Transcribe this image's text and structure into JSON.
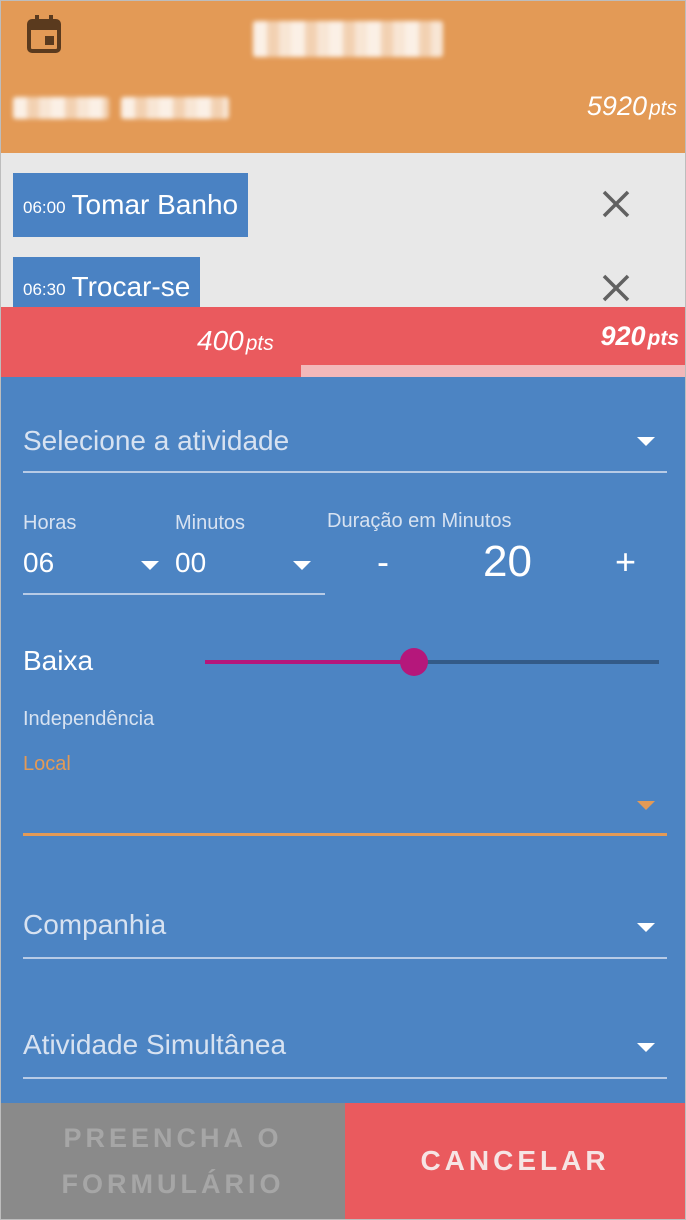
{
  "header": {
    "calendar_icon": "calendar-icon",
    "points_value": "5920",
    "points_unit": "pts"
  },
  "tasks": [
    {
      "time": "06:00",
      "name": "Tomar Banho",
      "remove_icon": "close-icon"
    },
    {
      "time": "06:30",
      "name": "Trocar-se",
      "remove_icon": "close-icon"
    }
  ],
  "points_bar": {
    "current_value": "400",
    "current_unit": "pts",
    "target_value": "920",
    "target_unit": "pts"
  },
  "form": {
    "activity_placeholder": "Selecione a atividade",
    "hours_label": "Horas",
    "hours_value": "06",
    "minutes_label": "Minutos",
    "minutes_value": "00",
    "duration_label": "Duração em Minutos",
    "duration_minus": "-",
    "duration_value": "20",
    "duration_plus": "+",
    "intensity_label": "Baixa",
    "intensity_level": 0.46,
    "independence_label": "Independência",
    "local_label": "Local",
    "companhia_placeholder": "Companhia",
    "simultanea_placeholder": "Atividade Simultânea"
  },
  "buttons": {
    "fill_form_line1": "PREENCHA O",
    "fill_form_line2": "FORMULÁRIO",
    "cancel": "CANCELAR"
  },
  "colors": {
    "header": "#e39a56",
    "task": "#4a82c3",
    "form": "#4c84c3",
    "accent_red": "#ea5a5e",
    "slider": "#b5177b",
    "local_accent": "#e39a56",
    "disabled_button": "#8a8a8a"
  }
}
